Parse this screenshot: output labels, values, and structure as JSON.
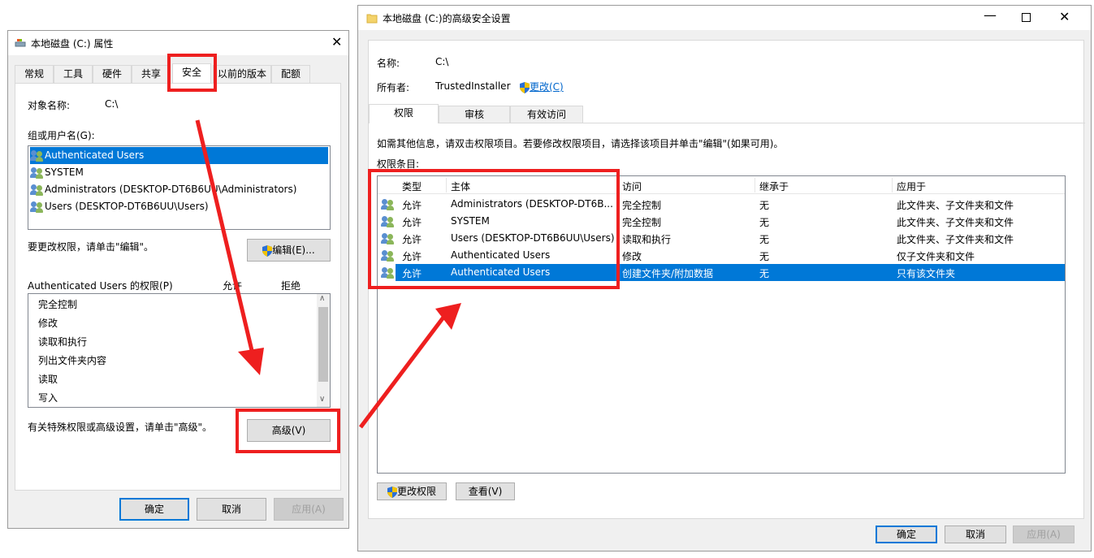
{
  "left_dialog": {
    "title": "本地磁盘 (C:) 属性",
    "tabs": [
      "常规",
      "工具",
      "硬件",
      "共享",
      "安全",
      "以前的版本",
      "配额"
    ],
    "object_label": "对象名称:",
    "object_value": "C:\\",
    "group_label": "组或用户名(G):",
    "users": [
      "Authenticated Users",
      "SYSTEM",
      "Administrators (DESKTOP-DT6B6UU\\Administrators)",
      "Users (DESKTOP-DT6B6UU\\Users)"
    ],
    "edit_hint": "要更改权限，请单击\"编辑\"。",
    "edit_button": "编辑(E)...",
    "perm_title": "Authenticated Users 的权限(P)",
    "col_allow": "允许",
    "col_deny": "拒绝",
    "permissions": [
      "完全控制",
      "修改",
      "读取和执行",
      "列出文件夹内容",
      "读取",
      "写入"
    ],
    "advanced_hint": "有关特殊权限或高级设置，请单击\"高级\"。",
    "advanced_button": "高级(V)",
    "ok": "确定",
    "cancel": "取消",
    "apply": "应用(A)"
  },
  "right_dialog": {
    "title": "本地磁盘 (C:)的高级安全设置",
    "name_label": "名称:",
    "name_value": "C:\\",
    "owner_label": "所有者:",
    "owner_value": "TrustedInstaller",
    "change_link": "更改(C)",
    "tabs": [
      "权限",
      "审核",
      "有效访问"
    ],
    "info": "如需其他信息，请双击权限项目。若要修改权限项目，请选择该项目并单击\"编辑\"(如果可用)。",
    "entries_label": "权限条目:",
    "columns": [
      "类型",
      "主体",
      "访问",
      "继承于",
      "应用于"
    ],
    "rows": [
      {
        "type": "允许",
        "principal": "Administrators (DESKTOP-DT6B...",
        "access": "完全控制",
        "inherited": "无",
        "applies": "此文件夹、子文件夹和文件"
      },
      {
        "type": "允许",
        "principal": "SYSTEM",
        "access": "完全控制",
        "inherited": "无",
        "applies": "此文件夹、子文件夹和文件"
      },
      {
        "type": "允许",
        "principal": "Users (DESKTOP-DT6B6UU\\Users)",
        "access": "读取和执行",
        "inherited": "无",
        "applies": "此文件夹、子文件夹和文件"
      },
      {
        "type": "允许",
        "principal": "Authenticated Users",
        "access": "修改",
        "inherited": "无",
        "applies": "仅子文件夹和文件"
      },
      {
        "type": "允许",
        "principal": "Authenticated Users",
        "access": "创建文件夹/附加数据",
        "inherited": "无",
        "applies": "只有该文件夹"
      }
    ],
    "change_perm_button": "更改权限",
    "view_button": "查看(V)",
    "ok": "确定",
    "cancel": "取消",
    "apply": "应用(A)"
  },
  "colors": {
    "accent": "#0078d7",
    "highlight": "#ee1f1f"
  }
}
